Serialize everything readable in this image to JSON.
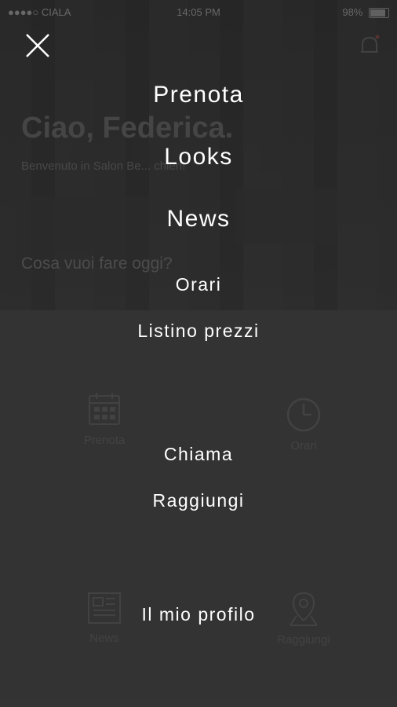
{
  "status_bar": {
    "carrier": "●●●●○ CIALA",
    "time": "14:05 PM",
    "battery": "98%"
  },
  "home": {
    "greeting": "Ciao, Federica.",
    "welcome": "Benvenuto in Salon Be... chieri!",
    "question": "Cosa vuoi fare oggi?",
    "grid": [
      {
        "label": "Prenota",
        "icon": "calendar-icon"
      },
      {
        "label": "Orari",
        "icon": "clock-icon"
      },
      {
        "label": "News",
        "icon": "newspaper-icon"
      },
      {
        "label": "Raggiungi",
        "icon": "map-pin-icon"
      }
    ]
  },
  "menu": {
    "close_icon": "close-icon",
    "items": [
      {
        "label": "Prenota"
      },
      {
        "label": "Looks"
      },
      {
        "label": "News"
      },
      {
        "label": "Orari"
      },
      {
        "label": "Listino prezzi"
      },
      {
        "label": "Chiama"
      },
      {
        "label": "Raggiungi"
      },
      {
        "label": "Il mio profilo"
      }
    ]
  },
  "colors": {
    "overlay_text": "#ffffff",
    "background": "#3a3a3a",
    "notification_dot": "#c0392b"
  }
}
